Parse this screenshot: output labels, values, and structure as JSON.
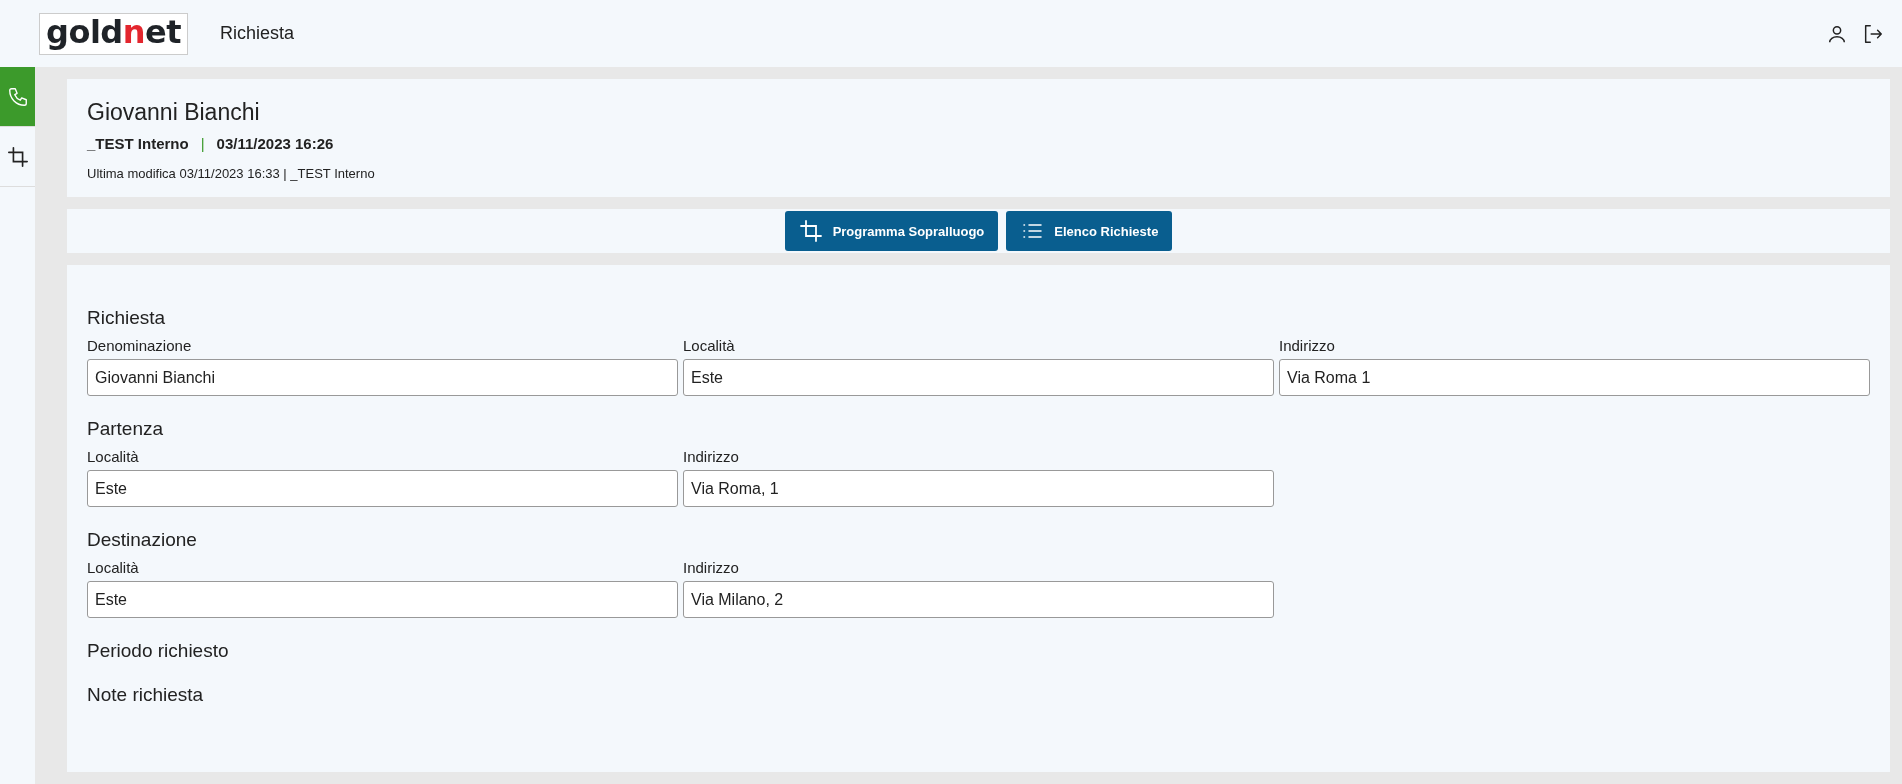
{
  "header": {
    "logo": {
      "start": "gold",
      "accent": "n",
      "end": "et"
    },
    "title": "Richiesta"
  },
  "sidebar": {
    "items": [
      {
        "kind": "phone",
        "selected": true
      },
      {
        "kind": "crop",
        "selected": false
      }
    ]
  },
  "summary": {
    "name": "Giovanni Bianchi",
    "owner": "_TEST Interno",
    "separator": "|",
    "date": "03/11/2023 16:26",
    "last_modified": "Ultima modifica 03/11/2023 16:33 | _TEST Interno"
  },
  "toolbar": {
    "buttons": [
      {
        "kind": "crop",
        "label": "Programma Sopralluogo"
      },
      {
        "kind": "list",
        "label": "Elenco Richieste"
      }
    ]
  },
  "sections": [
    {
      "title": "Richiesta",
      "fields": [
        {
          "label": "Denominazione",
          "value": "Giovanni Bianchi"
        },
        {
          "label": "Località",
          "value": "Este"
        },
        {
          "label": "Indirizzo",
          "value": "Via Roma 1"
        }
      ]
    },
    {
      "title": "Partenza",
      "fields": [
        {
          "label": "Località",
          "value": "Este"
        },
        {
          "label": "Indirizzo",
          "value": "Via Roma, 1"
        }
      ]
    },
    {
      "title": "Destinazione",
      "fields": [
        {
          "label": "Località",
          "value": "Este"
        },
        {
          "label": "Indirizzo",
          "value": "Via Milano, 2"
        }
      ]
    },
    {
      "title": "Periodo richiesto"
    },
    {
      "title": "Note richiesta"
    }
  ]
}
